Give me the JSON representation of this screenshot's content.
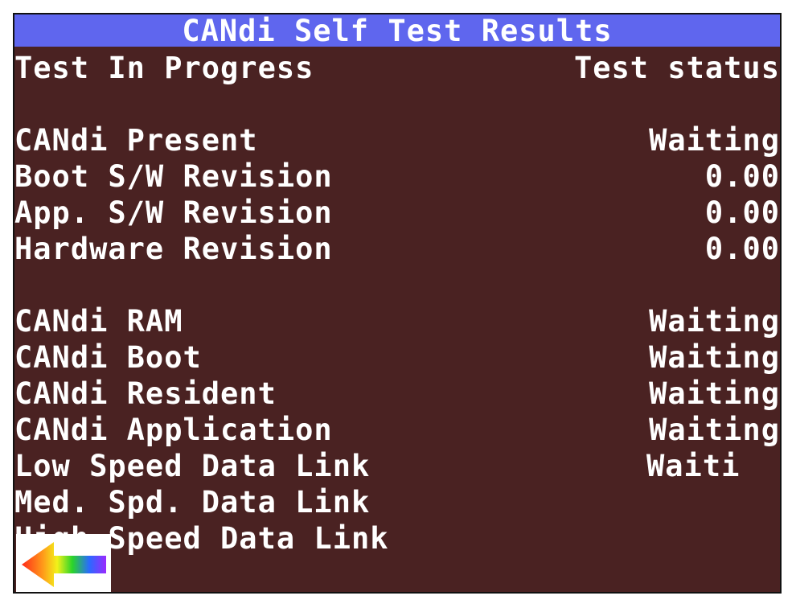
{
  "window": {
    "title": "CANdi Self Test Results"
  },
  "header": {
    "left": "Test In Progress",
    "right": "Test status"
  },
  "info_rows": [
    {
      "label": "CANdi Present",
      "value": "Waiting"
    },
    {
      "label": "Boot S/W Revision",
      "value": "0.00"
    },
    {
      "label": "App. S/W Revision",
      "value": "0.00"
    },
    {
      "label": "Hardware Revision",
      "value": "0.00"
    }
  ],
  "test_rows": [
    {
      "label": "CANdi RAM",
      "value": "Waiting"
    },
    {
      "label": "CANdi Boot",
      "value": "Waiting"
    },
    {
      "label": "CANdi Resident",
      "value": "Waiting"
    },
    {
      "label": "CANdi Application",
      "value": "Waiting"
    },
    {
      "label": "Low Speed Data Link",
      "value": "Waiti"
    },
    {
      "label": "Med. Spd. Data Link",
      "value": ""
    },
    {
      "label": "High Speed Data Link",
      "value": ""
    }
  ],
  "back_button": {
    "icon": "rainbow-back-arrow-icon"
  },
  "colors": {
    "background": "#4a2222",
    "title_bar": "#5f66ee",
    "text": "#ffffff"
  }
}
